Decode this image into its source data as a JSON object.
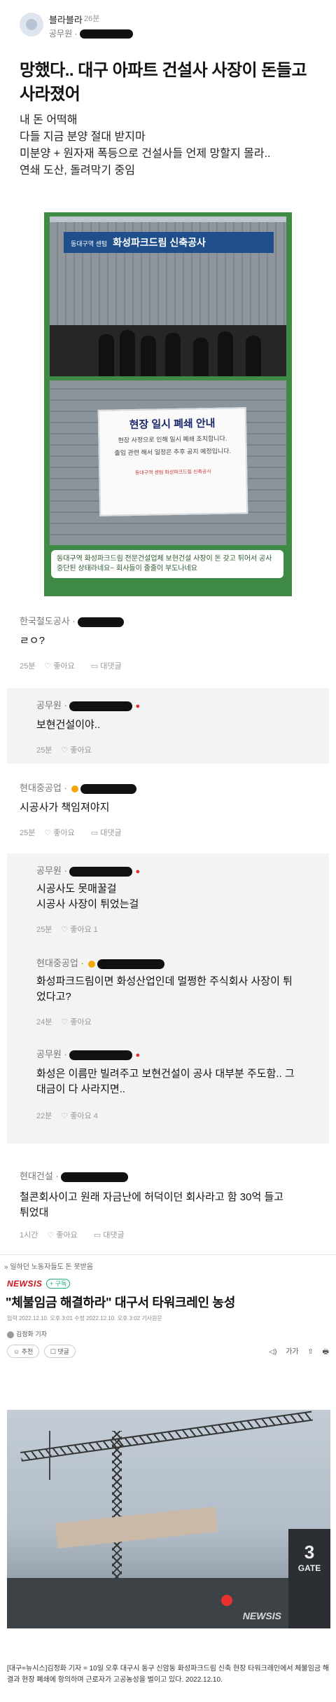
{
  "post": {
    "author": "블라블라",
    "time": "26분",
    "company": "공무원",
    "title": "망했다.. 대구 아파트 건설사 사장이 돈들고 사라졌어",
    "body_lines": [
      "내 돈 어떡해",
      "다들 지금 분양 절대 받지마",
      "미분양 + 원자재 폭등으로 건설사들 언제 망할지 몰라..",
      "연쇄 도산, 돌려막기 중임"
    ],
    "image": {
      "sign_small": "동대구역 센텀",
      "sign": "화성파크드림 신축공사",
      "notice_title": "현장 일시 폐쇄 안내",
      "notice_lines": [
        "현장 사정으로 인해 일시 폐쇄 조치합니다.",
        "출입 관련 해서 일정은 추후 공지 예정입니다."
      ],
      "notice_foot": "동대구역 센텀 화성파크드림 신축공사",
      "caption": "동대구역 화성파크드림 전문건설업체 보현건설 사장이 돈 갖고 튀어서 공사 중단된 상태라네요~ 회사들이 줄줄이 부도나네요"
    }
  },
  "comments": [
    {
      "company": "한국철도공사",
      "text": "ㄹㅇ?",
      "time": "25분",
      "like": "좋아요",
      "reply": "대댓글"
    },
    {
      "company": "공무원",
      "text": "보현건설이야..",
      "time": "25분",
      "like": "좋아요"
    },
    {
      "company": "현대중공업",
      "text": "시공사가 책임져야지",
      "time": "25분",
      "like": "좋아요",
      "reply": "대댓글"
    },
    {
      "company": "공무원",
      "text_lines": [
        "시공사도 못매꿀걸",
        "시공사 사장이 튀었는걸"
      ],
      "time": "25분",
      "like": "좋아요 1"
    },
    {
      "company": "현대중공업",
      "text_lines": [
        "화성파크드림이면 화성산업인데 멀쩡한 주식회사 사장이 튀",
        "었다고?"
      ],
      "time": "24분",
      "like": "좋아요"
    },
    {
      "company": "공무원",
      "text_lines": [
        "화성은 이름만 빌려주고 보현건설이 공사 대부분 주도함.. 그",
        "대금이 다 사라지면.."
      ],
      "time": "22분",
      "like": "좋아요 4"
    },
    {
      "company": "현대건설",
      "text_lines": [
        "철콘회사이고 원래 자금난에 허덕이던 회사라고 함 30억 들고",
        "튀었대"
      ],
      "time": "1시간",
      "like": "좋아요",
      "reply": "대댓글"
    }
  ],
  "news": {
    "label": "» 일하던 노동자들도 돈 못받음",
    "logo": "NEWSIS",
    "subscribe": "+ 구독",
    "headline": "\"체불임금 해결하라\" 대구서 타워크레인 농성",
    "dates": "입력 2022.12.10. 오후 3:01   수정 2022.12.10. 오후 3:02   기사원문",
    "reporter": "김정화 기자",
    "action_recommend": "추천",
    "action_comment": "댓글",
    "tools": [
      "◁)",
      "가가",
      "⇧",
      "🖶"
    ],
    "photo_gate": "3",
    "photo_gate_sub": "GATE",
    "photo_watermark": "NEWSIS",
    "caption": "[대구=뉴시스]김정화 기자 = 10일 오후 대구시 동구 신암동 화성파크드림 신축 현장 타워크레인에서 체불임금 해결과 현장 폐쇄에 항의하며 근로자가 고공농성을 벌이고 있다. 2022.12.10."
  }
}
